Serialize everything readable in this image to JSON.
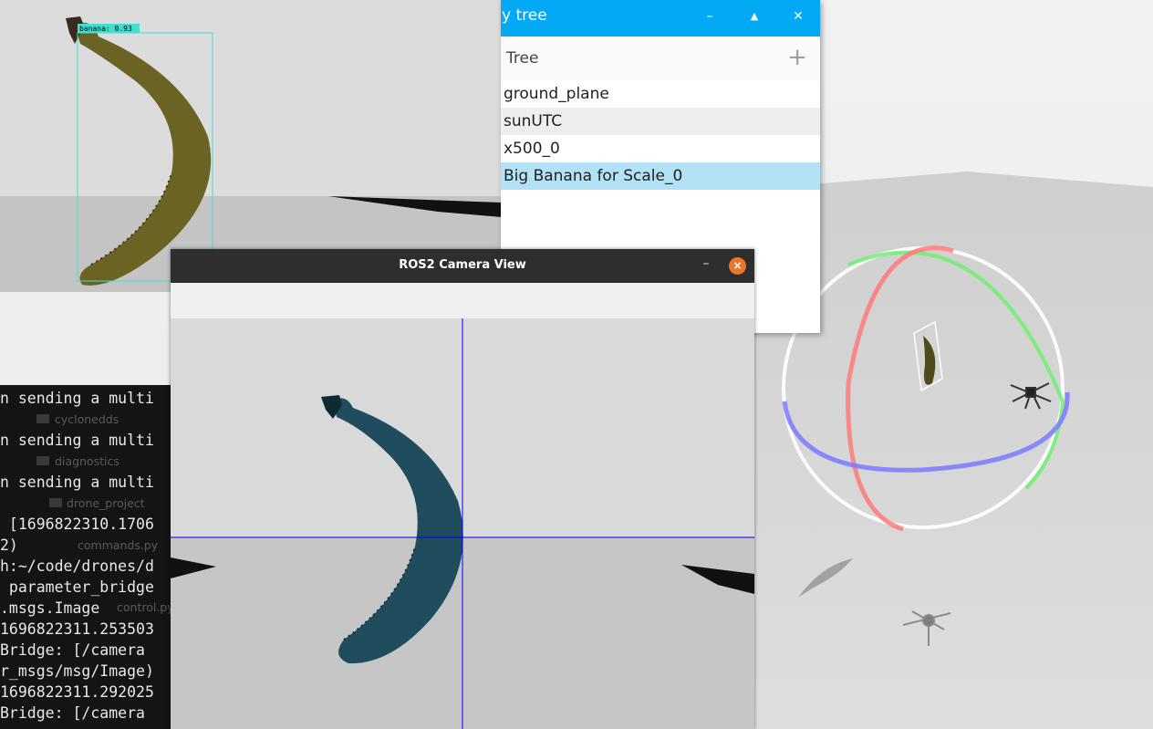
{
  "detection": {
    "label": "banana: 0.93",
    "box_color": "#40e0d0"
  },
  "entity_tree": {
    "title": "y tree",
    "section_label": "Tree",
    "add_icon": "plus-icon",
    "window_buttons": {
      "minimize": "–",
      "maximize": "▲",
      "close": "✕"
    },
    "items": [
      {
        "label": "ground_plane"
      },
      {
        "label": "sunUTC"
      },
      {
        "label": "x500_0"
      },
      {
        "label": "Big Banana for Scale_0"
      }
    ],
    "accent": "#03a9f4",
    "selected_color": "#b3e1f5"
  },
  "camera_window": {
    "title": "ROS2 Camera View",
    "minimize": "–",
    "close": "×",
    "crosshair_color": "#0000ff"
  },
  "terminal": {
    "lines": [
      "n sending a multi",
      "n sending a multi",
      "n sending a multi",
      " [1696822310.1706",
      "2)",
      "h:~/code/drones/d",
      " parameter_bridge",
      ".msgs.Image",
      "1696822311.253503",
      "Bridge: [/camera",
      "r_msgs/msg/Image)",
      "1696822311.292025",
      "Bridge: [/camera"
    ],
    "ghost_items": [
      "cyclonedds",
      "diagnostics",
      "drone_project",
      "commands.py",
      "control.py"
    ]
  }
}
